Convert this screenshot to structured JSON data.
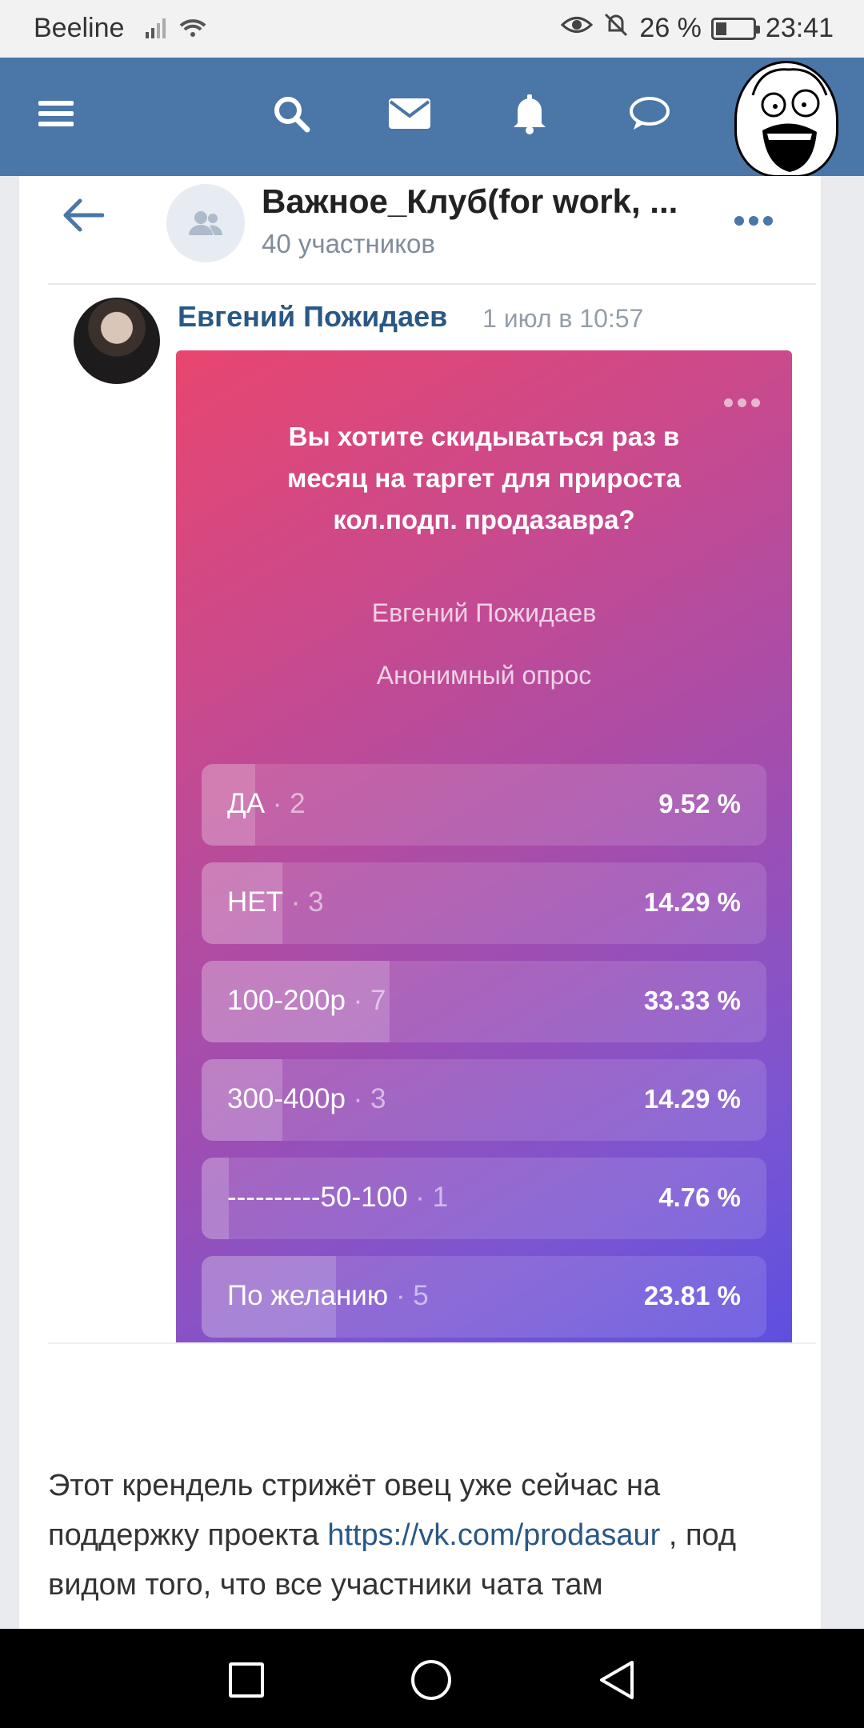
{
  "status_bar": {
    "carrier": "Beeline",
    "battery": "26 %",
    "time": "23:41"
  },
  "header": {
    "icons": [
      "menu-icon",
      "search-icon",
      "mail-icon",
      "bell-icon",
      "chat-icon"
    ]
  },
  "chat": {
    "title": "Важное_Клуб(for work, ...",
    "members": "40 участников"
  },
  "post": {
    "author": "Евгений Пожидаев",
    "date": "1 июл в 10:57"
  },
  "poll": {
    "question": "Вы хотите скидываться раз в месяц на  таргет для прироста кол.подп. продазавра?",
    "author": "Евгений Пожидаев",
    "type": "Анонимный опрос",
    "options": [
      {
        "label": "ДА",
        "count": "· 2",
        "percent": "9.52 %"
      },
      {
        "label": "НЕТ",
        "count": "· 3",
        "percent": "14.29 %"
      },
      {
        "label": "100-200р",
        "count": "· 7",
        "percent": "33.33 %"
      },
      {
        "label": "300-400р",
        "count": "· 3",
        "percent": "14.29 %"
      },
      {
        "label": "----------50-100",
        "count": "· 1",
        "percent": "4.76 %"
      },
      {
        "label": "По желанию",
        "count": "· 5",
        "percent": "23.81 %"
      }
    ],
    "fractions": [
      0.0952,
      0.1429,
      0.3333,
      0.1429,
      0.0476,
      0.2381
    ]
  },
  "message": {
    "part1": "Этот крендель стрижёт овец уже сейчас на поддержку проекта ",
    "link": "https://vk.com/prodasaur",
    "part2": " , под видом того, что все участники чата там"
  },
  "colors": {
    "header": "#4a76a8",
    "link": "#2a5885"
  }
}
